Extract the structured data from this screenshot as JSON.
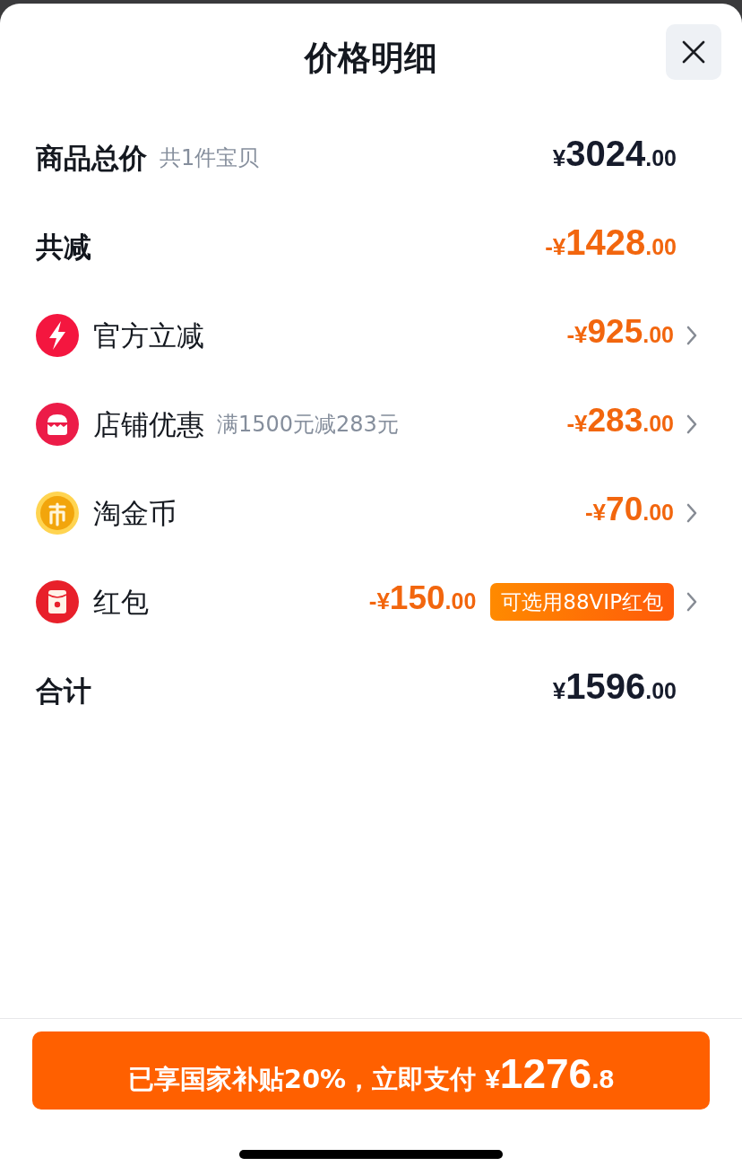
{
  "header": {
    "title": "价格明细"
  },
  "subtotal": {
    "label": "商品总价",
    "note": "共1件宝贝",
    "amount": {
      "currency": "¥",
      "whole": "3024",
      "cents": ".00"
    }
  },
  "reduction": {
    "label": "共减",
    "amount": {
      "currency": "-¥",
      "whole": "1428",
      "cents": ".00"
    }
  },
  "discounts": [
    {
      "kind": "official",
      "label": "官方立减",
      "amount": {
        "currency": "-¥",
        "whole": "925",
        "cents": ".00"
      }
    },
    {
      "kind": "store",
      "label": "店铺优惠",
      "note": "满1500元减283元",
      "amount": {
        "currency": "-¥",
        "whole": "283",
        "cents": ".00"
      }
    },
    {
      "kind": "coin",
      "label": "淘金币",
      "amount": {
        "currency": "-¥",
        "whole": "70",
        "cents": ".00"
      }
    },
    {
      "kind": "red_packet",
      "label": "红包",
      "amount": {
        "currency": "-¥",
        "whole": "150",
        "cents": ".00"
      },
      "badge": "可选用88VIP红包"
    }
  ],
  "total": {
    "label": "合计",
    "amount": {
      "currency": "¥",
      "whole": "1596",
      "cents": ".00"
    }
  },
  "pay_button": {
    "text": "已享国家补贴20%，立即支付",
    "currency": "¥",
    "whole": "1276",
    "cents": ".8"
  }
}
